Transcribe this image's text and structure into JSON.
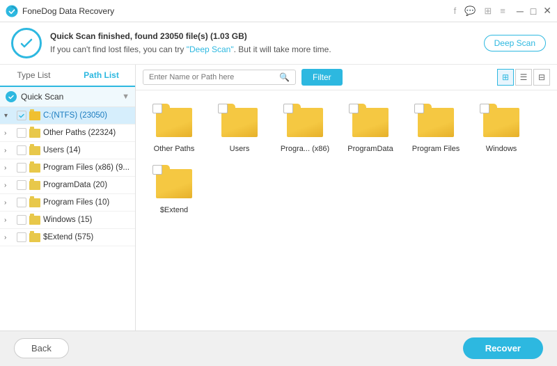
{
  "titleBar": {
    "appName": "FoneDog Data Recovery",
    "controls": [
      "f",
      "speech",
      "grid",
      "menu",
      "minimize",
      "maximize",
      "close"
    ]
  },
  "notification": {
    "line1": "Quick Scan finished, found 23050 file(s) (1.03 GB)",
    "line2prefix": "If you can't find lost files, you can try ",
    "deepScanLink": "\"Deep Scan\"",
    "line2suffix": ". But it will take more time.",
    "deepScanBtn": "Deep Scan"
  },
  "tabs": {
    "typeList": "Type List",
    "pathList": "Path List"
  },
  "sidebar": {
    "quickScan": "Quick Scan",
    "rootNode": "C:(NTFS) (23050)",
    "items": [
      {
        "label": "Other Paths (22324)",
        "count": 22324
      },
      {
        "label": "Users (14)",
        "count": 14
      },
      {
        "label": "Program Files (x86) (9...",
        "count": 9
      },
      {
        "label": "ProgramData (20)",
        "count": 20
      },
      {
        "label": "Program Files (10)",
        "count": 10
      },
      {
        "label": "Windows (15)",
        "count": 15
      },
      {
        "label": "$Extend (575)",
        "count": 575
      }
    ]
  },
  "toolbar": {
    "searchPlaceholder": "Enter Name or Path here",
    "filterBtn": "Filter"
  },
  "files": [
    {
      "name": "Other Paths"
    },
    {
      "name": "Users"
    },
    {
      "name": "Progra... (x86)"
    },
    {
      "name": "ProgramData"
    },
    {
      "name": "Program Files"
    },
    {
      "name": "Windows"
    },
    {
      "name": "$Extend"
    }
  ],
  "bottomBar": {
    "backBtn": "Back",
    "recoverBtn": "Recover"
  }
}
